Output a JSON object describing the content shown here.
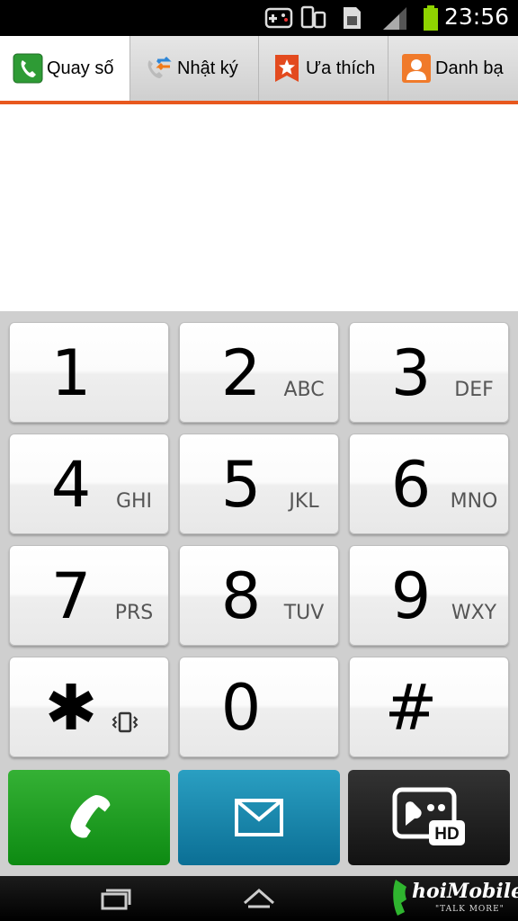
{
  "status_bar": {
    "time": "23:56",
    "icons": [
      "gamepad-icon",
      "phone-devices-icon",
      "sim-card-icon",
      "signal-icon",
      "battery-icon"
    ],
    "battery_color": "#8fd400"
  },
  "tabs": [
    {
      "label": "Quay số",
      "icon": "phone-handset-icon",
      "active": true
    },
    {
      "label": "Nhật ký",
      "icon": "call-log-icon",
      "active": false
    },
    {
      "label": "Ưa thích",
      "icon": "star-bookmark-icon",
      "active": false
    },
    {
      "label": "Danh bạ",
      "icon": "contact-person-icon",
      "active": false
    }
  ],
  "accent_color": "#e8581e",
  "keypad": {
    "keys": [
      {
        "digit": "1",
        "letters": ""
      },
      {
        "digit": "2",
        "letters": "ABC"
      },
      {
        "digit": "3",
        "letters": "DEF"
      },
      {
        "digit": "4",
        "letters": "GHI"
      },
      {
        "digit": "5",
        "letters": "JKL"
      },
      {
        "digit": "6",
        "letters": "MNO"
      },
      {
        "digit": "7",
        "letters": "PRS"
      },
      {
        "digit": "8",
        "letters": "TUV"
      },
      {
        "digit": "9",
        "letters": "WXY"
      },
      {
        "digit": "✱",
        "letters": ""
      },
      {
        "digit": "0",
        "letters": ""
      },
      {
        "digit": "#",
        "letters": ""
      }
    ]
  },
  "actions": [
    {
      "name": "call",
      "icon": "phone-call-icon",
      "color": "#1a9a1f"
    },
    {
      "name": "message",
      "icon": "envelope-icon",
      "color": "#12789f"
    },
    {
      "name": "video-call",
      "icon": "hd-video-call-icon",
      "color": "#1c1c1c"
    }
  ],
  "watermark": {
    "text": "hoiMobile",
    "subtext": "\"TALK MORE\""
  }
}
